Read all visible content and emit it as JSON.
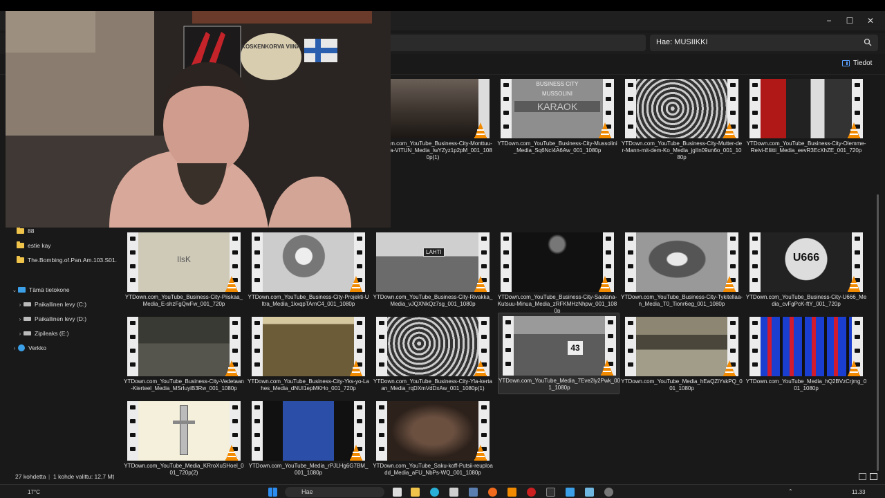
{
  "window": {
    "search": {
      "text": "Hae: MUSIIKKI"
    },
    "details_label": "Tiedot",
    "controls": {
      "minimize": "−",
      "maximize": "☐",
      "close": "✕"
    }
  },
  "nav": {
    "items": [
      {
        "label": "88",
        "icon": "folder-icon"
      },
      {
        "label": "estie kay",
        "icon": "folder-icon"
      },
      {
        "label": "The.Bombing.of.Pan.Am.103.S01.",
        "icon": "folder-icon"
      },
      {
        "label": "Tämä tietokone",
        "icon": "pc-icon"
      },
      {
        "label": "Paikallinen levy (C:)",
        "icon": "drive-icon"
      },
      {
        "label": "Paikallinen levy (D:)",
        "icon": "drive-icon"
      },
      {
        "label": "Zipileaks (E:)",
        "icon": "drive-icon"
      },
      {
        "label": "Verkko",
        "icon": "network-icon"
      }
    ]
  },
  "files": [
    {
      "label": "YTDown.com_YouTube_Business-City-Monttuu-mukana-VITUN_Media_lwYZyz1p2pM_001_1080p(1)",
      "selected": false
    },
    {
      "label": "YTDown.com_YouTube_Business-City-Mussolini_Media_Sq6NcI4A6Aw_001_1080p",
      "selected": false
    },
    {
      "label": "YTDown.com_YouTube_Business-City-Mutter-der-Mann-mit-dem-Ko_Media_jgIIn09un6o_001_1080p",
      "selected": false
    },
    {
      "label": "YTDown.com_YouTube_Business-City-Olemme-Reivi-Eliitti_Media_eevR3EcXhZE_001_720p",
      "selected": false
    },
    {
      "label": "YTDown.com_YouTube_Business-City-Piiskaa_Media_E-shzFgQwFw_001_720p",
      "selected": false
    },
    {
      "label": "YTDown.com_YouTube_Business-City-Projekti-Ultra_Media_1kxqpTArnC4_001_1080p",
      "selected": false
    },
    {
      "label": "YTDown.com_YouTube_Business-City-Rivakka_Media_vJQXNkQz7sg_001_1080p",
      "selected": false
    },
    {
      "label": "YTDown.com_YouTube_Business-City-Saatana-Kutsuu-Minua_Media_zRFKMHzNhpw_001_1080p",
      "selected": false
    },
    {
      "label": "YTDown.com_YouTube_Business-City-Tykitellaa-n_Media_T0_Tionr6eg_001_1080p",
      "selected": false
    },
    {
      "label": "YTDown.com_YouTube_Business-City-U666_Media_cvFgPcK-ftY_001_720p",
      "selected": false
    },
    {
      "label": "YTDown.com_YouTube_Business-City-Vedetaan-Kierteel_Media_MSrIuyiB3Rw_001_1080p",
      "selected": false
    },
    {
      "label": "YTDown.com_YouTube_Business-City-Yks-yo-Lahes_Media_dNUI1epMKHo_001_720p",
      "selected": false
    },
    {
      "label": "YTDown.com_YouTube_Business-City-Yla-kertaan_Media_rqDXmVdDxAw_001_1080p(1)",
      "selected": false
    },
    {
      "label": "YTDown.com_YouTube_Media_7Eve2ly2Pwk_001_1080p",
      "selected": true
    },
    {
      "label": "YTDown.com_YouTube_Media_hEaQZlYskPQ_001_1080p",
      "selected": false
    },
    {
      "label": "YTDown.com_YouTube_Media_hQ2BVzCrjmg_001_1080p",
      "selected": false
    },
    {
      "label": "YTDown.com_YouTube_Media_KRroXuSHoel_001_720p(2)",
      "selected": false
    },
    {
      "label": "YTDown.com_YouTube_Media_rPJLHg6G7BM_001_1080p",
      "selected": false
    },
    {
      "label": "YTDown.com_YouTube_Saku-koff-Putsii-reuploadd_Media_aFU_NbPs-WQ_001_1080p",
      "selected": false
    }
  ],
  "thumbnails": {
    "business_city": "BUSINESS CITY",
    "mussolini": "MUSSOLINI",
    "karaoke": "KARAOK",
    "lahti": "LAHTI",
    "u666": "U666",
    "ilsk": "IlsK",
    "bib": "43"
  },
  "webcam": {
    "poster_text": "KOSKENKORVA VIINA"
  },
  "status": {
    "item_count": "27 kohdetta",
    "selection": "1 kohde valittu: 12,7 Mt"
  },
  "taskbar": {
    "weather": "17°C",
    "search": "Hae",
    "time": "11.33"
  }
}
